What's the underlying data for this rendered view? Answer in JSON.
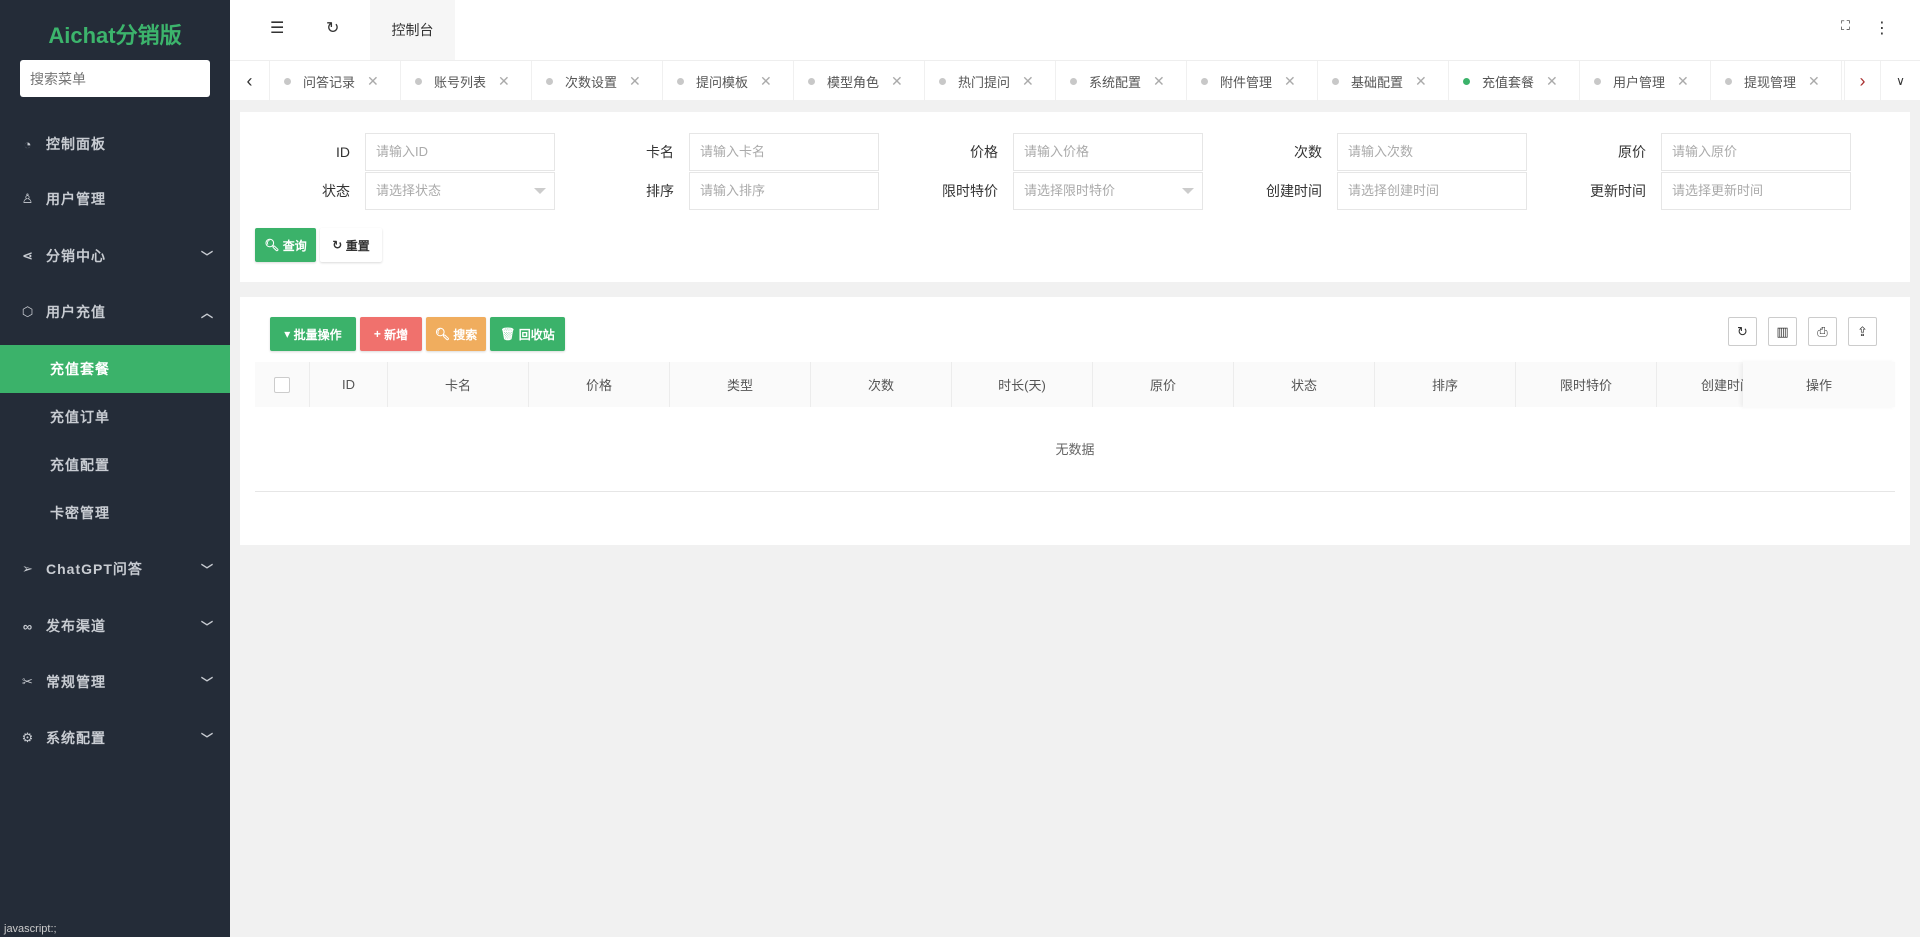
{
  "sidebar": {
    "logo": "Aichat分销版",
    "search_placeholder": "搜索菜单",
    "items": [
      {
        "label": "控制面板",
        "icon": "dashboard-icon"
      },
      {
        "label": "用户管理",
        "icon": "user-icon"
      },
      {
        "label": "分销中心",
        "icon": "share-icon"
      },
      {
        "label": "用户充值",
        "icon": "cube-icon"
      },
      {
        "label": "ChatGPT问答",
        "icon": "paper-plane-icon"
      },
      {
        "label": "发布渠道",
        "icon": "infinity-icon"
      },
      {
        "label": "常规管理",
        "icon": "tools-icon"
      },
      {
        "label": "系统配置",
        "icon": "gear-icon"
      }
    ],
    "subitems": [
      "充值套餐",
      "充值订单",
      "充值配置",
      "卡密管理"
    ],
    "status": "javascript:;"
  },
  "header": {
    "home_tab": "控制台"
  },
  "tabs": [
    "问答记录",
    "账号列表",
    "次数设置",
    "提问模板",
    "模型角色",
    "热门提问",
    "系统配置",
    "附件管理",
    "基础配置",
    "充值套餐",
    "用户管理",
    "提现管理"
  ],
  "active_tab": "充值套餐",
  "colors": {
    "accent": "#3bb26a",
    "danger": "#f0716d",
    "warning": "#f0ad5e",
    "sidebar": "#242c38"
  },
  "filters": [
    {
      "label": "ID",
      "placeholder": "请输入ID"
    },
    {
      "label": "卡名",
      "placeholder": "请输入卡名"
    },
    {
      "label": "价格",
      "placeholder": "请输入价格"
    },
    {
      "label": "次数",
      "placeholder": "请输入次数"
    },
    {
      "label": "原价",
      "placeholder": "请输入原价"
    },
    {
      "label": "状态",
      "placeholder": "请选择状态",
      "select": true
    },
    {
      "label": "排序",
      "placeholder": "请输入排序"
    },
    {
      "label": "限时特价",
      "placeholder": "请选择限时特价",
      "select": true
    },
    {
      "label": "创建时间",
      "placeholder": "请选择创建时间"
    },
    {
      "label": "更新时间",
      "placeholder": "请选择更新时间"
    }
  ],
  "form_buttons": {
    "query": "查询",
    "reset": "重置"
  },
  "toolbar": {
    "batch": "批量操作",
    "add": "新增",
    "search": "搜索",
    "recycle": "回收站"
  },
  "table": {
    "columns": [
      "ID",
      "卡名",
      "价格",
      "类型",
      "次数",
      "时长(天)",
      "原价",
      "状态",
      "排序",
      "限时特价",
      "创建时间"
    ],
    "action_col": "操作",
    "empty": "无数据"
  }
}
